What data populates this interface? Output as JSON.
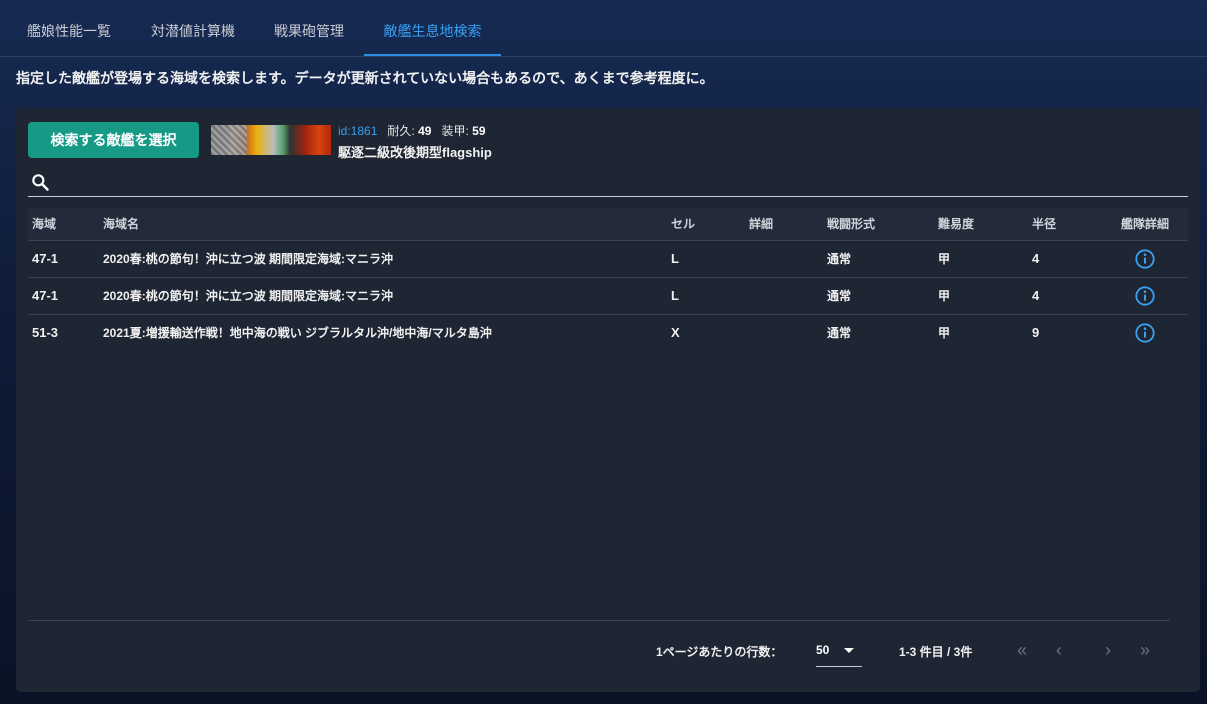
{
  "tabs": [
    {
      "label": "艦娘性能一覧",
      "active": false
    },
    {
      "label": "対潜値計算機",
      "active": false
    },
    {
      "label": "戦果砲管理",
      "active": false
    },
    {
      "label": "敵艦生息地検索",
      "active": true
    }
  ],
  "description": "指定した敵艦が登場する海域を検索します。データが更新されていない場合もあるので、あくまで参考程度に。",
  "enemy": {
    "select_button": "検索する敵艦を選択",
    "id_text": "id:1861",
    "hp_label": "耐久:",
    "hp_value": "49",
    "armor_label": "装甲:",
    "armor_value": "59",
    "name": "駆逐二級改後期型flagship"
  },
  "search": {
    "value": "",
    "placeholder": ""
  },
  "table": {
    "headers": [
      "海域",
      "海域名",
      "セル",
      "詳細",
      "戦闘形式",
      "難易度",
      "半径",
      "艦隊詳細"
    ],
    "rows": [
      {
        "area": "47-1",
        "name": "2020春:桃の節句！沖に立つ波 期間限定海域:マニラ沖",
        "cell": "L",
        "detail": "",
        "battle": "通常",
        "difficulty": "甲",
        "radius": "4"
      },
      {
        "area": "47-1",
        "name": "2020春:桃の節句！沖に立つ波 期間限定海域:マニラ沖",
        "cell": "L",
        "detail": "",
        "battle": "通常",
        "difficulty": "甲",
        "radius": "4"
      },
      {
        "area": "51-3",
        "name": "2021夏:増援輸送作戦！地中海の戦い ジブラルタル沖/地中海/マルタ島沖",
        "cell": "X",
        "detail": "",
        "battle": "通常",
        "difficulty": "甲",
        "radius": "9"
      }
    ]
  },
  "pagination": {
    "rows_per_page_label": "1ページあたりの行数：",
    "rows_per_page": "50",
    "range": "1-3 件目 / 3件",
    "first_icon": "«",
    "prev_icon": "‹",
    "next_icon": "›",
    "last_icon": "»"
  },
  "colors": {
    "accent": "#3aa0f0",
    "button": "#169a86",
    "panel": "#1e2533"
  }
}
